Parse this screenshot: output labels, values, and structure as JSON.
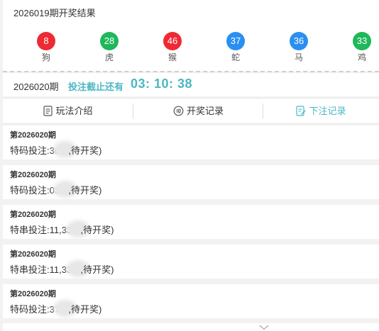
{
  "results": {
    "title": "2026019期开奖结果",
    "balls": [
      {
        "number": "8",
        "zodiac": "狗",
        "color": "#ee2a34"
      },
      {
        "number": "28",
        "zodiac": "虎",
        "color": "#1eb85a"
      },
      {
        "number": "46",
        "zodiac": "猴",
        "color": "#ee2a34"
      },
      {
        "number": "37",
        "zodiac": "蛇",
        "color": "#2a8ff0"
      },
      {
        "number": "36",
        "zodiac": "马",
        "color": "#2a8ff0"
      },
      {
        "number": "33",
        "zodiac": "鸡",
        "color": "#1eb85a"
      }
    ]
  },
  "countdown": {
    "issue": "2026020期",
    "label": "投注截止还有",
    "time": "03: 10: 38",
    "accent": "#4bb7c2"
  },
  "tabs": [
    {
      "label": "玩法介绍",
      "icon": "rules-doc-icon"
    },
    {
      "label": "开奖记录",
      "icon": "history-clock-icon"
    },
    {
      "label": "下注记录",
      "icon": "bet-record-icon",
      "active": true
    }
  ],
  "records": [
    {
      "issue": "第2026020期",
      "prefix": "特码投注:30(",
      "suffix": ",待开奖)"
    },
    {
      "issue": "第2026020期",
      "prefix": "特码投注:03(",
      "suffix": ",待开奖)"
    },
    {
      "issue": "第2026020期",
      "prefix": "特串投注:11,33(",
      "suffix": ",待开奖)"
    },
    {
      "issue": "第2026020期",
      "prefix": "特串投注:11,33(",
      "suffix": ",待开奖)"
    },
    {
      "issue": "第2026020期",
      "prefix": "特码投注:37(",
      "suffix": ",待开奖)"
    }
  ]
}
